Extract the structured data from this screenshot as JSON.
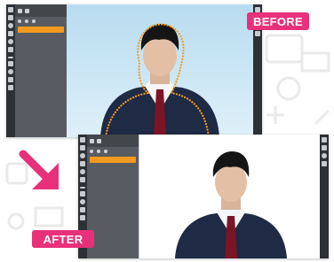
{
  "labels": {
    "before": "BEFORE",
    "after": "AFTER"
  },
  "colors": {
    "accent_pink": "#e8317a",
    "app_dark": "#3a3d42",
    "panel_gray": "#585c62",
    "button_orange": "#f39a1f",
    "selection_dots": "#f39a1f",
    "sky_blue": "#b7dcef"
  },
  "icons": {
    "arrow": "diagonal-arrow-down-right",
    "selection": "dotted-selection-outline"
  }
}
